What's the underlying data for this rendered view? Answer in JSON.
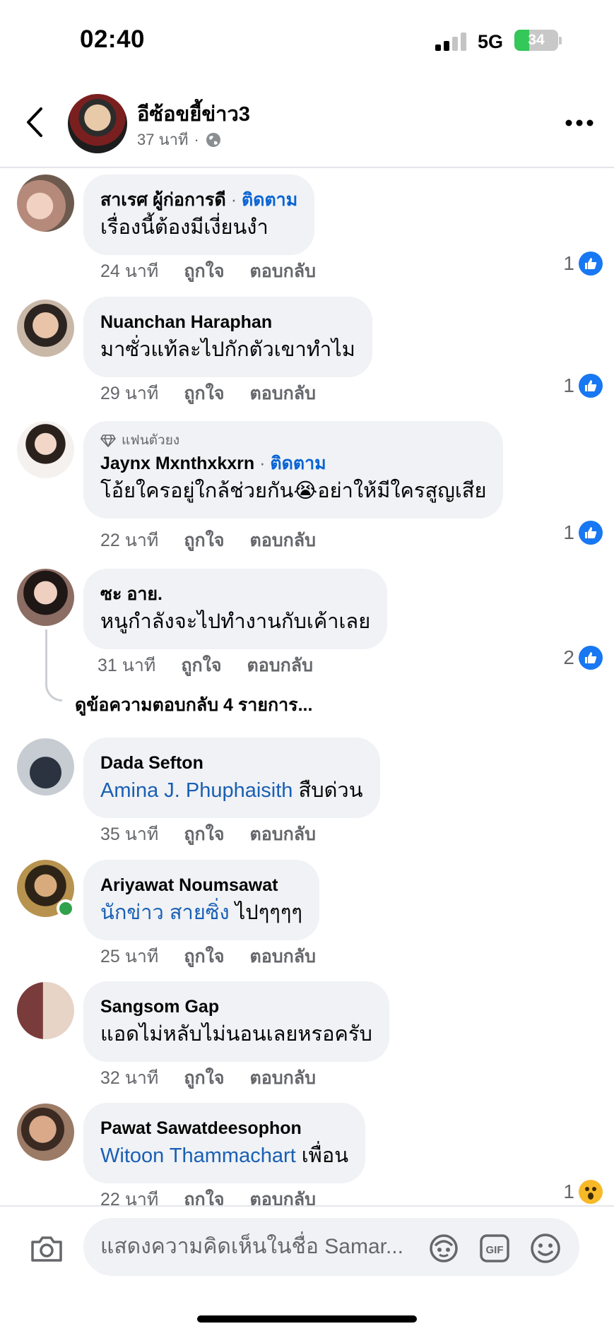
{
  "status": {
    "time": "02:40",
    "network": "5G",
    "battery": "34",
    "battery_level": 0.34,
    "colors": {
      "battery_fill": "#34c759"
    }
  },
  "header": {
    "page_name": "อีซ้อขยี้ข่าว3",
    "time_ago": "37 นาที",
    "privacy_icon": "globe-icon",
    "dot": "·"
  },
  "labels": {
    "like": "ถูกใจ",
    "reply": "ตอบกลับ",
    "follow": "ติดตาม",
    "dot": "·"
  },
  "comments": [
    {
      "author": "สาเรศ ผู้ก่อการดี",
      "text": "เรื่องนี้ต้องมีเงี่ยนงำ",
      "time": "24 นาที",
      "reactions": "1",
      "reaction_type": "like"
    },
    {
      "author": "Nuanchan Haraphan",
      "text": "มาซั่วแท้ละไปกักตัวเขาทำไม",
      "time": "29 นาที",
      "reactions": "1",
      "reaction_type": "like"
    },
    {
      "badge": "แฟนตัวยง",
      "author": "Jaynx Mxnthxkxrn",
      "text": "โอ้ยใครอยู่ใกล้ช่วยกัน😭อย่าให้มีใครสูญเสีย",
      "time": "22 นาที",
      "reactions": "1",
      "reaction_type": "like"
    },
    {
      "author": "ซะ อาย.",
      "text": "หนูกำลังจะไปทำงานกับเค้าเลย",
      "time": "31 นาที",
      "reactions": "2",
      "reaction_type": "like",
      "view_replies": "ดูข้อความตอบกลับ 4 รายการ..."
    },
    {
      "author": "Dada Sefton",
      "mention": "Amina J. Phuphaisith",
      "text": " สืบด่วน",
      "time": "35 นาที"
    },
    {
      "author": "Ariyawat Noumsawat",
      "mention": "นักข่าว สายซิ่ง",
      "text": " ไปๆๆๆๆ",
      "time": "25 นาที"
    },
    {
      "author": "Sangsom Gap",
      "text": "แอดไม่หลับไม่นอนเลยหรอครับ",
      "time": "32 นาที"
    },
    {
      "author": "Pawat Sawatdeesophon",
      "mention": "Witoon Thammachart",
      "text": " เพื่อน",
      "time": "22 นาที",
      "reactions": "1",
      "reaction_type": "wow"
    }
  ],
  "composer": {
    "placeholder": "แสดงความคิดเห็นในชื่อ Samar..."
  },
  "colors": {
    "follow_blue": "#0864d4",
    "mention_blue": "#1a5fb4",
    "bubble_bg": "#f0f2f5",
    "like_blue": "#1877f2",
    "secondary_text": "#65676b"
  }
}
